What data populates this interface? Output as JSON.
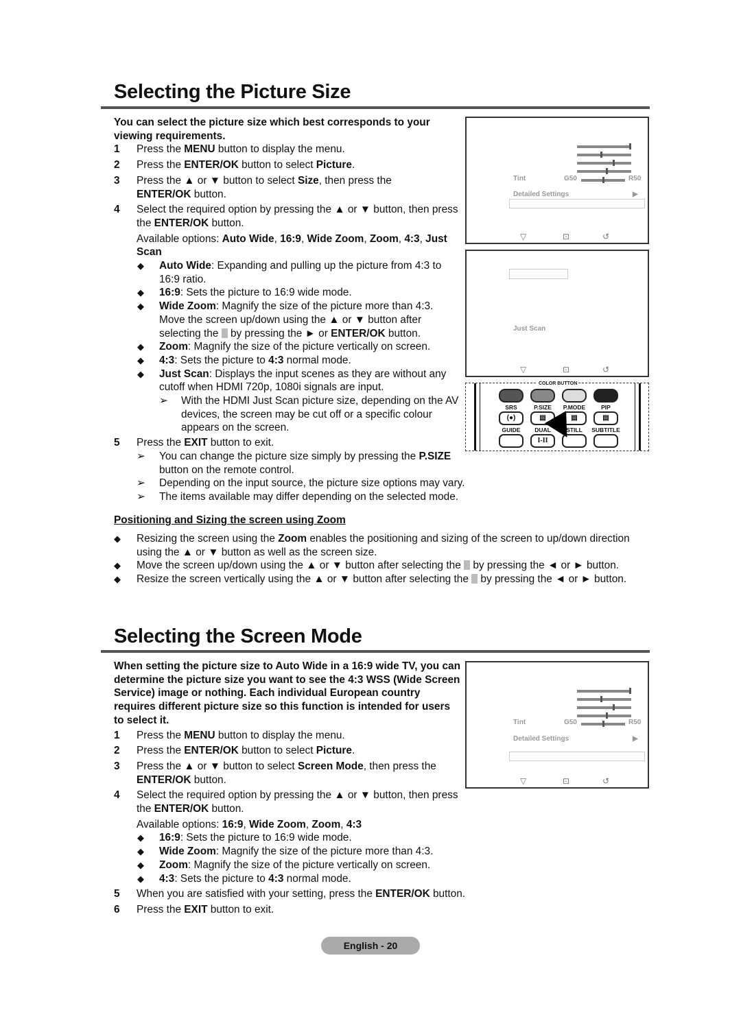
{
  "section1": {
    "title": "Selecting the Picture Size",
    "intro": "You can select the picture size which best corresponds to your viewing requirements.",
    "steps": [
      {
        "num": "1",
        "pre": "Press the ",
        "b1": "MENU",
        "post": " button to display the menu."
      },
      {
        "num": "2",
        "pre": "Press the ",
        "b1": "ENTER/OK",
        "mid": " button to select ",
        "b2": "Picture",
        "post": "."
      },
      {
        "num": "3",
        "pre": "Press the ▲ or ▼ button to select ",
        "b1": "Size",
        "mid": ", then press the ",
        "b2": "ENTER/OK",
        "post": " button."
      },
      {
        "num": "4",
        "pre": "Select the required option by pressing the ▲ or ▼ button, then press the ",
        "b1": "ENTER/OK",
        "post": " button."
      },
      {
        "num": "5",
        "pre": "Press the ",
        "b1": "EXIT",
        "post": " button to exit."
      }
    ],
    "options_prefix": "Available options: ",
    "options": [
      "Auto Wide",
      "16:9",
      "Wide Zoom",
      "Zoom",
      "4:3",
      "Just Scan"
    ],
    "bullets": [
      {
        "term": "Auto Wide",
        "text": ": Expanding and pulling up the picture from 4:3 to 16:9 ratio."
      },
      {
        "term": "16:9",
        "text": ": Sets the picture to 16:9 wide mode."
      },
      {
        "term": "Wide Zoom",
        "text": ": Magnify the size of the picture more than 4:3. Move the screen up/down using the ▲ or ▼ button after selecting the ",
        "text2": " by pressing the ► or ",
        "b": "ENTER/OK",
        "text3": " button."
      },
      {
        "term": "Zoom",
        "text": ": Magnify the size of the picture vertically on screen."
      },
      {
        "term": "4:3",
        "text": ": Sets the picture to ",
        "b": "4:3",
        "text2": " normal mode."
      },
      {
        "term": "Just Scan",
        "text": ": Displays the input scenes as they are without any cutoff when HDMI 720p, 1080i signals are input."
      }
    ],
    "justscan_note": "With the HDMI Just Scan picture size, depending on the AV devices, the screen may be cut off or a specific colour appears on the screen.",
    "notes": [
      {
        "pre": "You can change the picture size simply by pressing the ",
        "b": "P.SIZE",
        "post": " button on the remote control."
      },
      {
        "pre": "Depending on the input source, the picture size options may vary."
      },
      {
        "pre": "The items available may differ depending on the selected mode."
      }
    ]
  },
  "zoom_section": {
    "title": "Positioning and Sizing the screen using Zoom",
    "bullets": [
      {
        "pre": "Resizing the screen using the ",
        "b": "Zoom",
        "post": " enables the positioning and sizing of the screen to up/down direction using the ▲ or ▼ button as well as the screen size."
      },
      {
        "pre": "Move the screen up/down using the ▲ or ▼ button after selecting the ",
        "post": " by pressing the ◄ or ► button."
      },
      {
        "pre": "Resize the screen vertically using the ▲ or ▼ button after selecting the ",
        "post": " by pressing the ◄ or ► button."
      }
    ]
  },
  "section2": {
    "title": "Selecting the Screen Mode",
    "intro": "When setting the picture size to Auto Wide in a 16:9 wide TV, you can determine the picture size you want to see the 4:3 WSS (Wide Screen Service) image or nothing. Each individual European country requires different picture size so this function is intended for users to select it.",
    "steps": [
      {
        "num": "1",
        "pre": "Press the ",
        "b1": "MENU",
        "post": " button to display the menu."
      },
      {
        "num": "2",
        "pre": "Press the ",
        "b1": "ENTER/OK",
        "mid": " button to select ",
        "b2": "Picture",
        "post": "."
      },
      {
        "num": "3",
        "pre": "Press the ▲ or ▼ button to select ",
        "b1": "Screen Mode",
        "mid": ", then press the ",
        "b2": "ENTER/OK",
        "post": " button."
      },
      {
        "num": "4",
        "pre": "Select the required option by pressing the ▲ or ▼ button, then press the ",
        "b1": "ENTER/OK",
        "post": " button."
      },
      {
        "num": "5",
        "pre": "When you are satisfied with your setting, press the ",
        "b1": "ENTER/OK",
        "post": " button."
      },
      {
        "num": "6",
        "pre": "Press the ",
        "b1": "EXIT",
        "post": " button to exit."
      }
    ],
    "options_prefix": "Available options: ",
    "options": [
      "16:9",
      "Wide Zoom",
      "Zoom",
      "4:3"
    ],
    "bullets": [
      {
        "term": "16:9",
        "text": ": Sets the picture to 16:9 wide mode."
      },
      {
        "term": "Wide Zoom",
        "text": ": Magnify the size of the picture more than 4:3."
      },
      {
        "term": "Zoom",
        "text": ": Magnify the size of the picture vertically on screen."
      },
      {
        "term": "4:3",
        "text": ": Sets the picture to ",
        "b": "4:3",
        "text2": " normal mode."
      }
    ]
  },
  "osd": {
    "tint_label": "Tint",
    "tint_left": "G50",
    "tint_right": "R50",
    "detailed_label": "Detailed Settings",
    "arrow": "▶",
    "just_scan": "Just Scan",
    "icons": {
      "move": "▽",
      "enter": "⊡",
      "return": "↺"
    },
    "slider_levels": [
      1.0,
      0.45,
      0.68,
      0.55
    ],
    "tint_level": 0.5
  },
  "remote": {
    "color_button_label": "COLOR BUTTON",
    "top_labels": [
      "SRS",
      "P.SIZE",
      "P.MODE",
      "PIP"
    ],
    "bottom_labels": [
      "GUIDE",
      "DUAL",
      "STILL",
      "SUBTITLE"
    ],
    "srs_glyph": "(●)",
    "dual_glyph": "I-II",
    "colors": [
      "#555555",
      "#888888",
      "#dddddd",
      "#222222"
    ]
  },
  "footer": {
    "page_label": "English - 20"
  }
}
